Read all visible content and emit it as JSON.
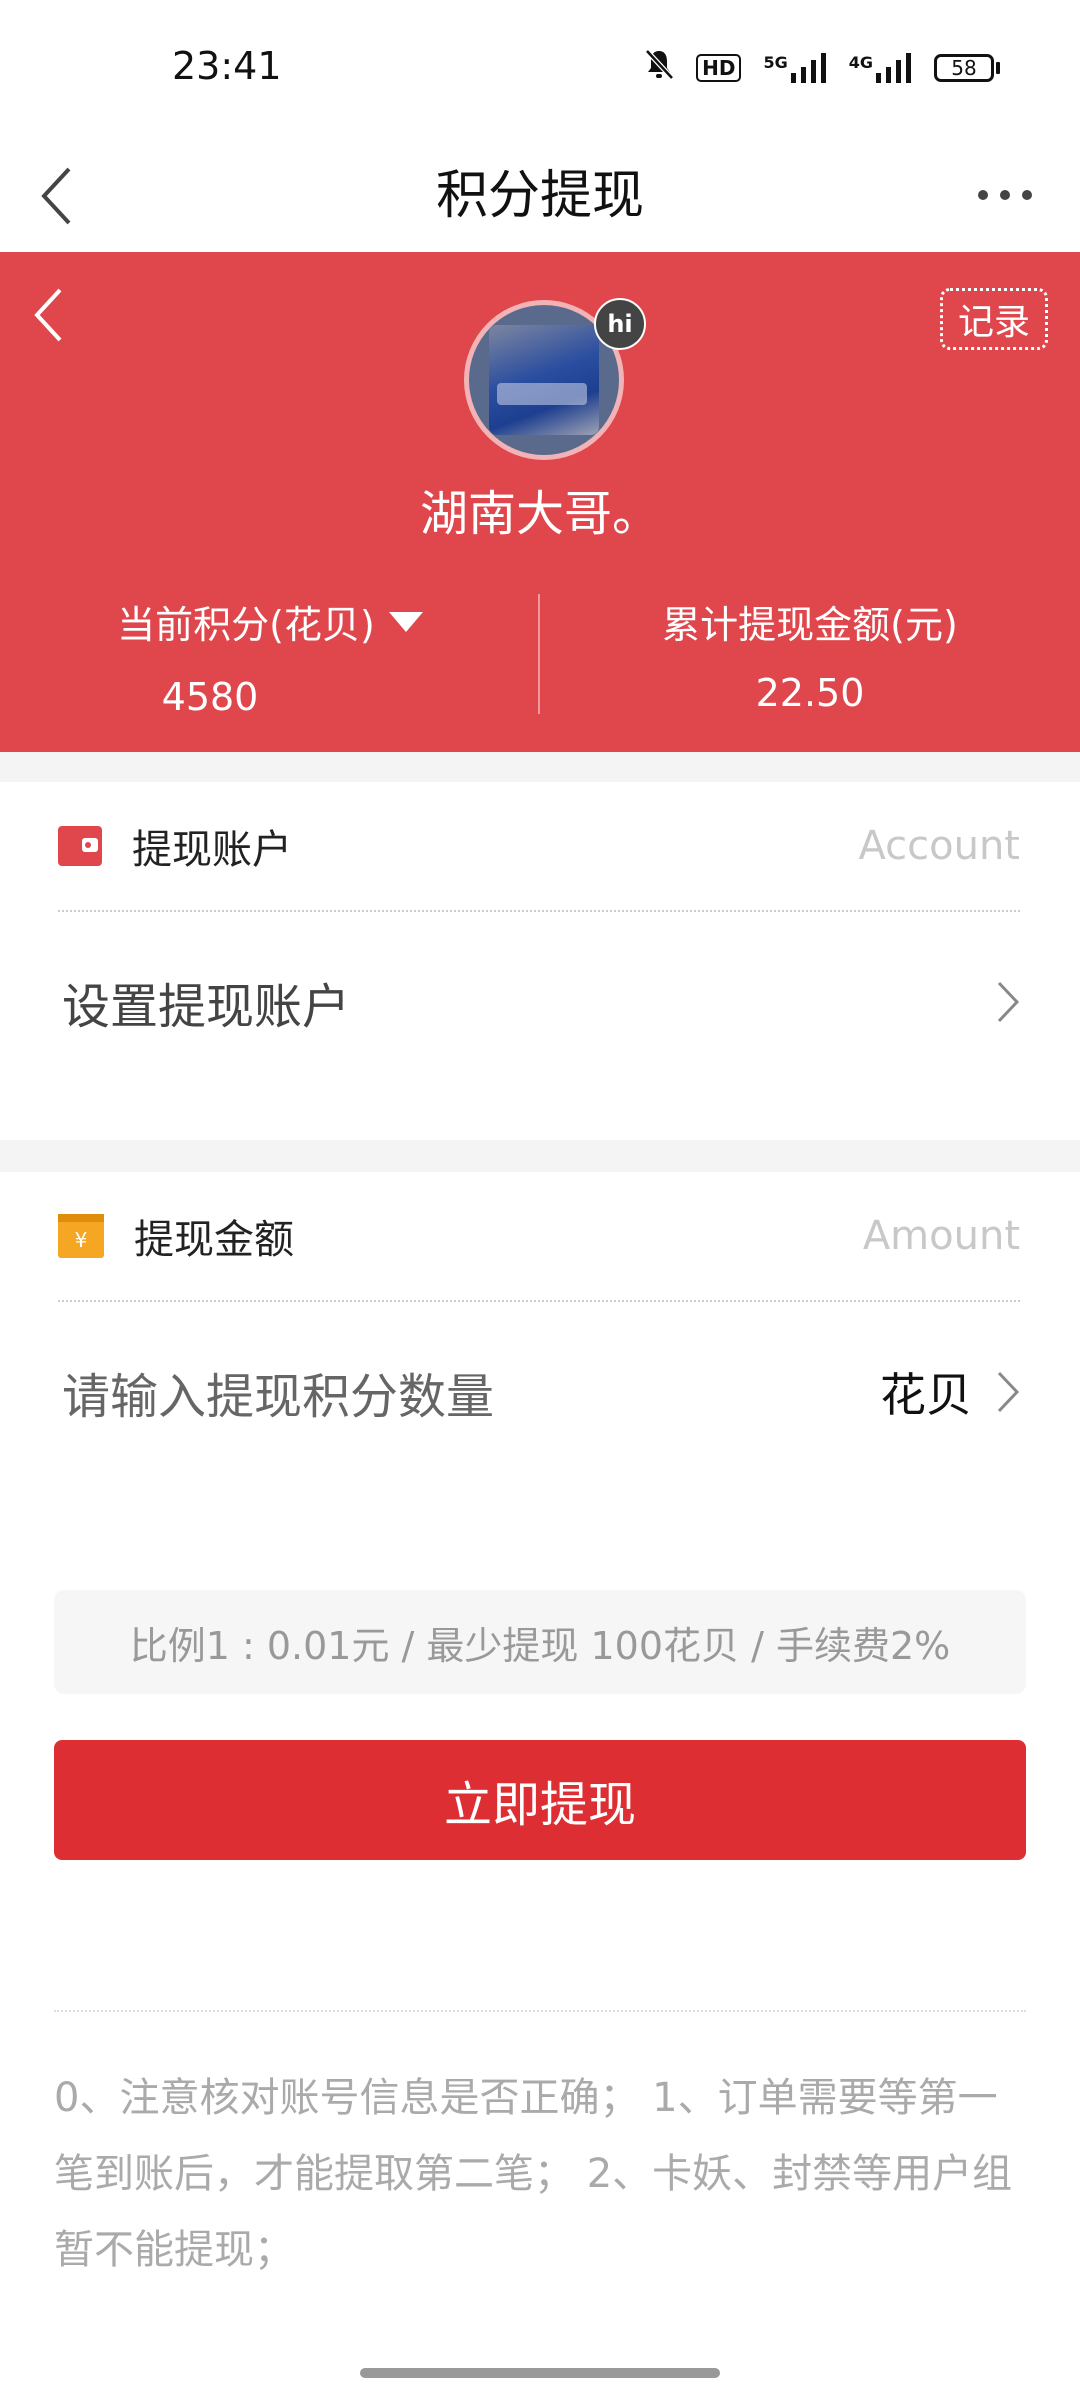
{
  "status_bar": {
    "time": "23:41",
    "hd_label": "HD",
    "net_5g": "5G",
    "net_4g": "4G",
    "battery": "58"
  },
  "nav": {
    "title": "积分提现"
  },
  "profile": {
    "username": "湖南大哥。",
    "badge": "hi",
    "record_label": "记录",
    "points_label": "当前积分(花贝)",
    "points_value": "4580",
    "total_label": "累计提现金额(元)",
    "total_value": "22.50"
  },
  "account_section": {
    "title": "提现账户",
    "hint": "Account",
    "row_text": "设置提现账户"
  },
  "amount_section": {
    "title": "提现金额",
    "hint": "Amount",
    "placeholder": "请输入提现积分数量",
    "unit": "花贝"
  },
  "ratio_text": "比例1 : 0.01元 / 最少提现 100花贝 / 手续费2%",
  "submit_label": "立即提现",
  "notice_text": "0、注意核对账号信息是否正确； 1、订单需要等第一笔到账后，才能提取第二笔； 2、卡妖、封禁等用户组暂不能提现；",
  "colors": {
    "hero": "#e0474d",
    "button": "#dd2f33",
    "wallet_icon": "#e0474d",
    "amount_icon": "#f5a623"
  }
}
